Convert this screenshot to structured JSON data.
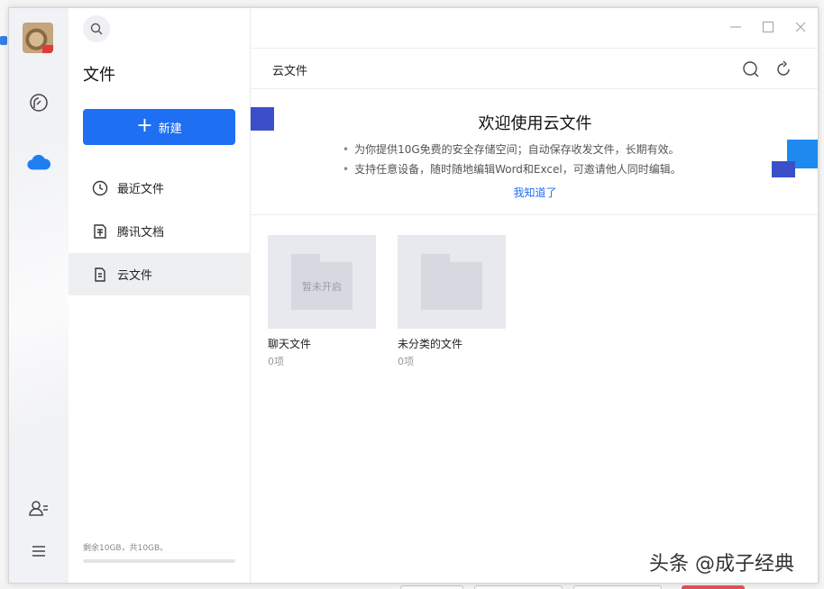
{
  "window": {
    "title": "文件"
  },
  "search": {
    "icon": "search-icon"
  },
  "sidebar": {
    "new_button": "新建",
    "items": [
      {
        "label": "最近文件",
        "icon": "clock-icon",
        "active": false
      },
      {
        "label": "腾讯文档",
        "icon": "document-icon",
        "active": false
      },
      {
        "label": "云文件",
        "icon": "file-icon",
        "active": true
      }
    ],
    "storage": {
      "text": "剩余10GB，共10GB。",
      "used_fraction": 0.0
    }
  },
  "main": {
    "breadcrumb": "云文件",
    "banner": {
      "title": "欢迎使用云文件",
      "lines": [
        "为你提供10G免费的安全存储空间；自动保存收发文件，长期有效。",
        "支持任意设备，随时随地编辑Word和Excel，可邀请他人同时编辑。"
      ],
      "link": "我知道了"
    },
    "folders": [
      {
        "name": "聊天文件",
        "count": "0项",
        "overlay": "暂未开启"
      },
      {
        "name": "未分类的文件",
        "count": "0项",
        "overlay": ""
      }
    ]
  },
  "watermark": "头条 @成子经典",
  "colors": {
    "accent": "#1f6ff2",
    "deco": "#3b4fc9",
    "deco_light": "#1e8af0"
  }
}
